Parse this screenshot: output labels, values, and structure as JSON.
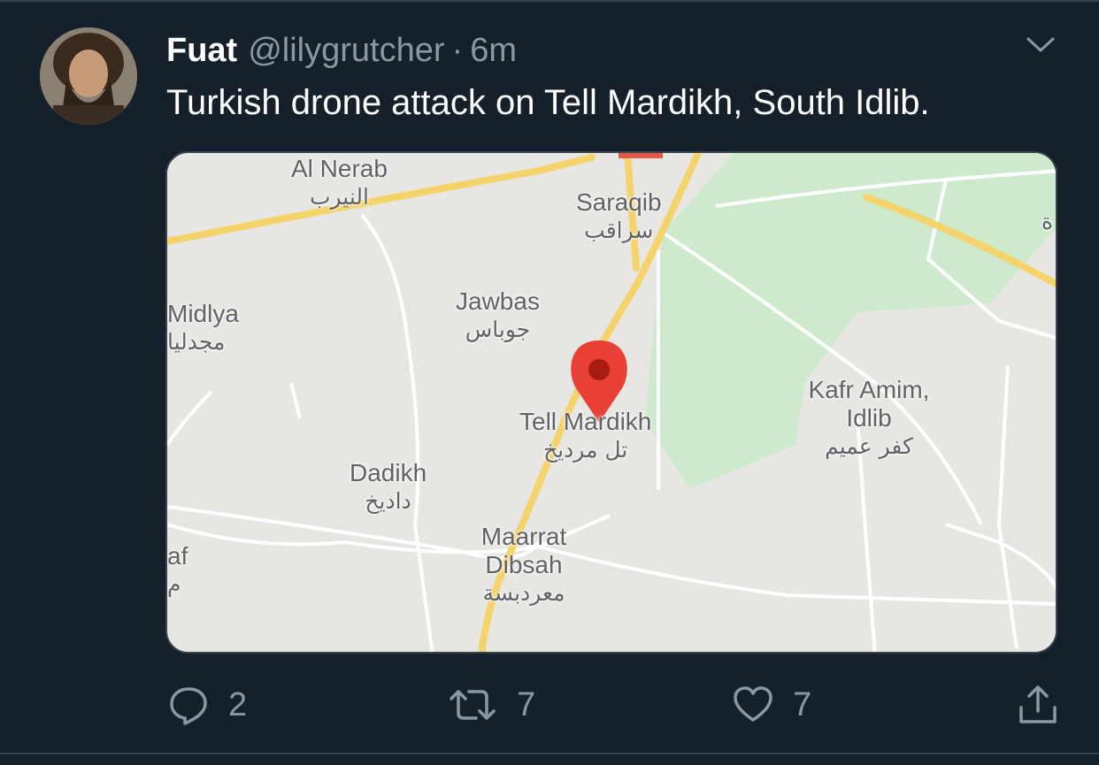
{
  "tweet": {
    "author_name": "Fuat",
    "handle": "@lilygrutcher",
    "separator": "·",
    "time": "6m",
    "text": "Turkish drone attack on Tell Mardikh, South Idlib."
  },
  "map": {
    "labels": {
      "al_nerab": {
        "en": "Al Nerab",
        "ar": "النيرب"
      },
      "saraqib": {
        "en": "Saraqib",
        "ar": "سراقب"
      },
      "midlya": {
        "en": "Midlya",
        "ar": "مجدليا"
      },
      "jawbas": {
        "en": "Jawbas",
        "ar": "جوباس"
      },
      "tell_mardikh": {
        "en": "Tell Mardikh",
        "ar": "تل مرديخ"
      },
      "kafr_amim": {
        "en": "Kafr Amim, Idlib",
        "ar": "كفر عميم"
      },
      "dadikh": {
        "en": "Dadikh",
        "ar": "داديخ"
      },
      "maarrat_dibsah": {
        "en": "Maarrat Dibsah",
        "ar": "معردبسة"
      },
      "edge_left": {
        "en": "af",
        "ar": "م"
      },
      "edge_right": {
        "ar": "ة"
      }
    },
    "colors": {
      "land": "#e8e6e3",
      "green": "#cdeacd",
      "major_road": "#f5d36b",
      "minor_road": "#ffffff",
      "pin": "#e84035"
    }
  },
  "actions": {
    "reply": {
      "icon": "reply-icon",
      "count": "2"
    },
    "retweet": {
      "icon": "retweet-icon",
      "count": "7"
    },
    "like": {
      "icon": "heart-icon",
      "count": "7"
    },
    "share": {
      "icon": "share-icon"
    }
  }
}
